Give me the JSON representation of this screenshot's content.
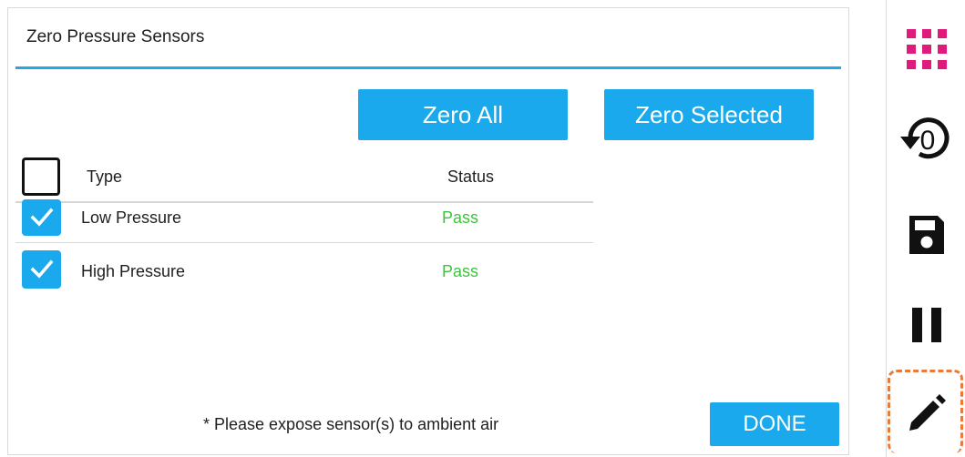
{
  "dialog": {
    "title": "Zero Pressure Sensors",
    "zero_all_label": "Zero All",
    "zero_selected_label": "Zero Selected",
    "columns": {
      "type": "Type",
      "status": "Status"
    },
    "rows": [
      {
        "type": "Low Pressure",
        "status": "Pass",
        "checked": true
      },
      {
        "type": "High Pressure",
        "status": "Pass",
        "checked": true
      }
    ],
    "footnote": "* Please expose sensor(s) to ambient air",
    "done_label": "DONE"
  },
  "toolbar": {
    "items": [
      {
        "icon": "grid-icon",
        "color": "#e0197d"
      },
      {
        "icon": "reset-zero-icon",
        "color": "#111111"
      },
      {
        "icon": "save-icon",
        "color": "#111111"
      },
      {
        "icon": "pause-icon",
        "color": "#111111"
      },
      {
        "icon": "edit-pencil-icon",
        "color": "#111111",
        "highlighted": true
      }
    ]
  },
  "colors": {
    "accent": "#1aa9ec",
    "pass": "#3cc43c",
    "grid_icon": "#e0197d",
    "highlight_dash": "#e87a3c"
  }
}
